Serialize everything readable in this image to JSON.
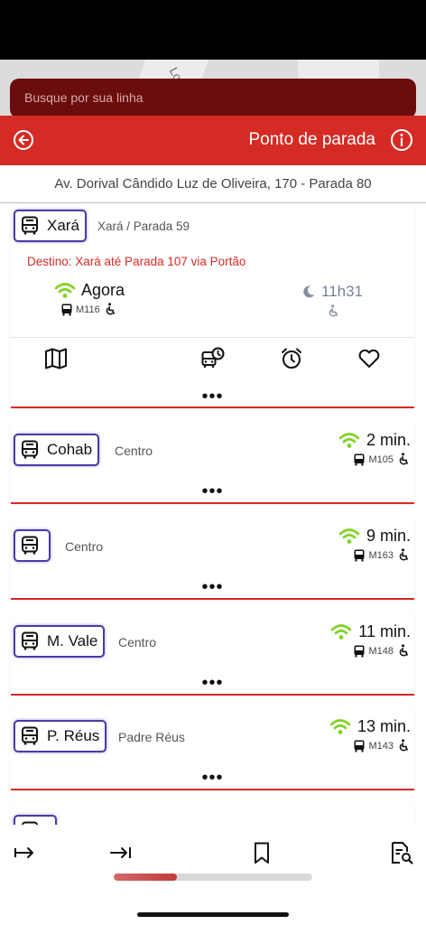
{
  "search": {
    "placeholder": "Busque por sua linha"
  },
  "map": {
    "street_label": "Lou"
  },
  "header": {
    "title": "Ponto de parada",
    "back_icon": "back-arrow-icon",
    "info_icon": "info-icon"
  },
  "stop": {
    "address": "Av. Dorival Cândido Luz de Oliveira, 170 - Parada 80"
  },
  "colors": {
    "primary": "#d42b25",
    "badge_border": "#4a3aa8",
    "signal": "#7ed321"
  },
  "first_arrival": {
    "line": "Xará",
    "destination_short": "Xará / Parada 59",
    "destination_full": "Destino: Xará até Parada 107 via Portão",
    "live": {
      "time": "Agora",
      "vehicle": "M116",
      "accessible": true
    },
    "scheduled": {
      "time": "11h31",
      "accessible": true
    },
    "actions": [
      "map-icon",
      "bus-schedule-icon",
      "alarm-icon",
      "favorite-heart-icon"
    ],
    "more": "•••"
  },
  "arrivals": [
    {
      "line": "Cohab",
      "destination": "Centro",
      "eta": "2 min.",
      "vehicle": "M105",
      "more": "•••"
    },
    {
      "line": "",
      "destination": "Centro",
      "eta": "9 min.",
      "vehicle": "M163",
      "more": "•••"
    },
    {
      "line": "M. Vale",
      "destination": "Centro",
      "eta": "11 min.",
      "vehicle": "M148",
      "more": "•••"
    },
    {
      "line": "P. Réus",
      "destination": "Padre Réus",
      "eta": "13 min.",
      "vehicle": "M143",
      "more": "•••"
    }
  ],
  "bottom_nav": {
    "icons": [
      "forward-step-icon",
      "skip-to-end-icon",
      "bookmark-icon",
      "document-search-icon"
    ],
    "progress": 0.32
  }
}
